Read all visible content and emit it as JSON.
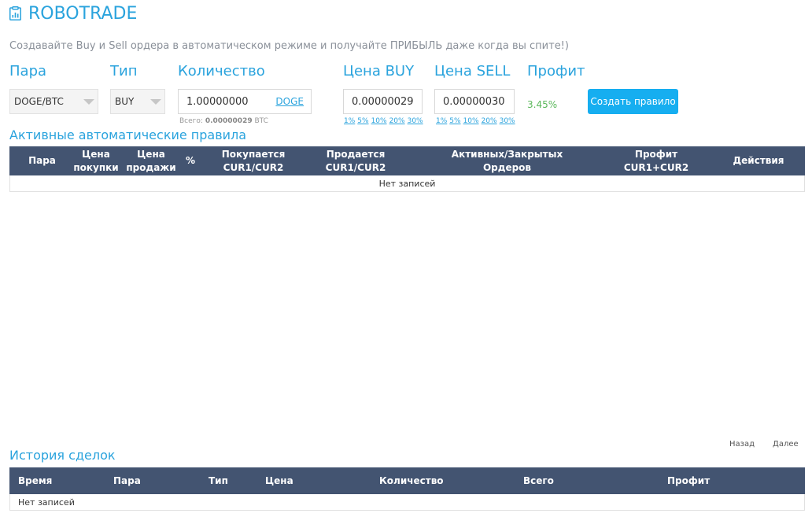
{
  "header": {
    "title": "ROBOTRADE",
    "icon": "clipboard-chart-icon"
  },
  "subtitle": "Создавайте Buy и Sell ордера в автоматическом режиме и получайте ПРИБЫЛЬ даже когда вы спите!)",
  "form": {
    "pair": {
      "label": "Пара",
      "value": "DOGE/BTC"
    },
    "type": {
      "label": "Тип",
      "value": "BUY"
    },
    "quantity": {
      "label": "Количество",
      "value": "1.00000000",
      "unit": "DOGE",
      "total_prefix": "Всего:",
      "total_value": "0.00000029",
      "total_unit": "BTC"
    },
    "buy_price": {
      "label": "Цена BUY",
      "value": "0.00000029"
    },
    "sell_price": {
      "label": "Цена SELL",
      "value": "0.00000030"
    },
    "percent_options": [
      "1%",
      "5%",
      "10%",
      "20%",
      "30%"
    ],
    "profit": {
      "label": "Профит",
      "value": "3.45%"
    },
    "create_button": "Создать правило"
  },
  "rules": {
    "title": "Активные автоматические правила",
    "columns": [
      "Пара",
      "Цена покупки",
      "Цена продажи",
      "%",
      "Покупается CUR1/CUR2",
      "Продается CUR1/CUR2",
      "Активных/Закрытых Ордеров",
      "Профит CUR1+CUR2",
      "Действия"
    ],
    "empty_text": "Нет записей"
  },
  "pager": {
    "prev": "Назад",
    "next": "Далее"
  },
  "history": {
    "title": "История сделок",
    "columns": [
      "Время",
      "Пара",
      "Тип",
      "Цена",
      "Количество",
      "Всего",
      "Профит"
    ],
    "empty_text": "Нет записей"
  },
  "colors": {
    "accent": "#2aa3dd",
    "button": "#16aef0",
    "table_header": "#435471",
    "profit": "#5cb85c"
  }
}
